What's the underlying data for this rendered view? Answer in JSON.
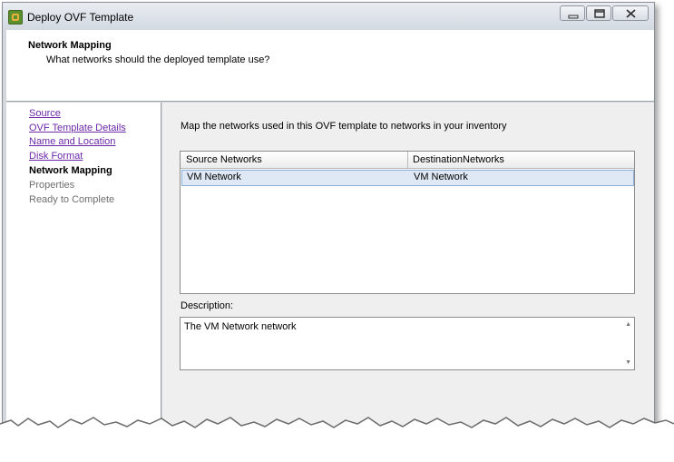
{
  "window": {
    "title": "Deploy OVF Template",
    "controls": [
      "minimize-icon",
      "maximize-icon",
      "close-icon"
    ]
  },
  "header": {
    "title": "Network Mapping",
    "subtitle": "What networks should the deployed template use?"
  },
  "nav": {
    "items": [
      {
        "label": "Source",
        "state": "link"
      },
      {
        "label": "OVF Template Details",
        "state": "link"
      },
      {
        "label": "Name and Location",
        "state": "link"
      },
      {
        "label": "Disk Format",
        "state": "link"
      },
      {
        "label": "Network Mapping",
        "state": "current"
      },
      {
        "label": "Properties",
        "state": "disabled"
      },
      {
        "label": "Ready to Complete",
        "state": "disabled"
      }
    ]
  },
  "main": {
    "intro": "Map the networks used in this OVF template to networks in your inventory",
    "table": {
      "columns": [
        "Source Networks",
        "DestinationNetworks"
      ],
      "rows": [
        {
          "source": "VM Network",
          "destination": "VM Network"
        }
      ]
    },
    "description_label": "Description:",
    "description_text": "The VM Network network"
  },
  "colors": {
    "link": "#6b29a8",
    "selection": "#dfe9f5",
    "panel": "#efefef",
    "app_icon": "#5d8f2f"
  }
}
